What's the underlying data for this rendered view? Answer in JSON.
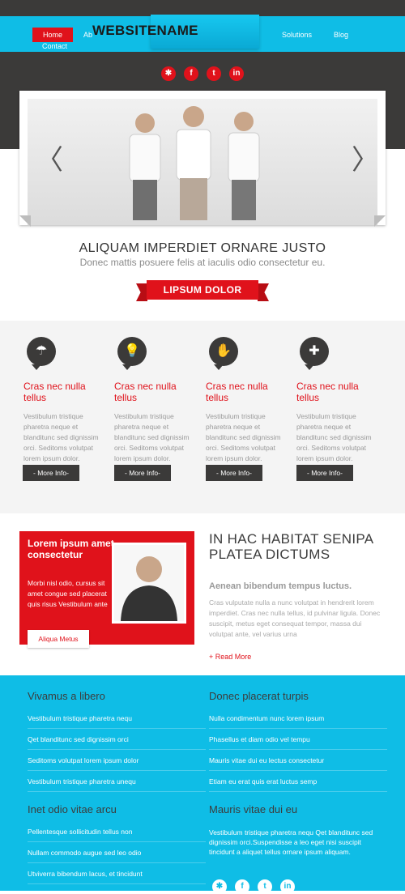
{
  "nav": {
    "logo": "WEBSITENAME",
    "home": "Home",
    "about": "Ab",
    "solutions": "Solutions",
    "blog": "Blog",
    "contact": "Contact"
  },
  "social": [
    {
      "icon": "stumbleupon-icon",
      "glyph": "✱"
    },
    {
      "icon": "facebook-icon",
      "glyph": "f"
    },
    {
      "icon": "twitter-icon",
      "glyph": "t"
    },
    {
      "icon": "linkedin-icon",
      "glyph": "in"
    }
  ],
  "hero": {
    "title": "ALIQUAM IMPERDIET ORNARE JUSTO",
    "subtitle": "Donec mattis posuere felis at iaculis odio consectetur eu.",
    "button": "LIPSUM DOLOR"
  },
  "features": [
    {
      "icon": "umbrella-icon",
      "glyph": "☂",
      "title": "Cras nec nulla tellus",
      "text": "Vestibulum tristique pharetra neque et blanditunc sed dignissim orci. Seditoms volutpat lorem ipsum dolor.",
      "button": "- More Info-"
    },
    {
      "icon": "lightbulb-icon",
      "glyph": "💡",
      "title": "Cras nec nulla tellus",
      "text": "Vestibulum tristique pharetra neque et blanditunc sed dignissim orci. Seditoms volutpat lorem ipsum dolor.",
      "button": "- More Info-"
    },
    {
      "icon": "hand-icon",
      "glyph": "✋",
      "title": "Cras nec nulla tellus",
      "text": "Vestibulum tristique pharetra neque et blanditunc sed dignissim orci. Seditoms volutpat lorem ipsum dolor.",
      "button": "- More Info-"
    },
    {
      "icon": "puzzle-icon",
      "glyph": "✚",
      "title": "Cras nec nulla tellus",
      "text": "Vestibulum tristique pharetra neque et blanditunc sed dignissim orci. Seditoms volutpat lorem ipsum dolor.",
      "button": "- More Info-"
    }
  ],
  "promo": {
    "title": "Lorem ipsum amet consectetur",
    "text": "Morbi nisl odio, cursus sit amet congue sed placerat quis risus Vestibulum ante",
    "button": "Aliqua Metus"
  },
  "about": {
    "title": "IN HAC HABITAT SENIPA PLATEA DICTUMS",
    "subtitle": "Aenean bibendum tempus luctus.",
    "text": "Cras vulputate nulla a nunc volutpat in hendrerit lorem imperdiet. Cras nec nulla tellus, id pulvinar ligula. Donec suscipit, metus eget consequat tempor, massa dui volutpat ante, vel varius urna",
    "link": "+ Read More"
  },
  "footer": {
    "col1_title": "Vivamus a libero",
    "col1_items": [
      "Vestibulum tristique pharetra nequ",
      "Qet blanditunc sed dignissim orci",
      "Seditoms volutpat lorem ipsum dolor",
      "Vestibulum tristique pharetra unequ"
    ],
    "col2_title": "Donec placerat turpis",
    "col2_items": [
      "Nulla condimentum nunc lorem ipsum",
      "Phasellus et diam odio vel tempu",
      "Mauris vitae dui eu lectus consectetur",
      "Etiam eu erat quis erat luctus semp"
    ],
    "col3_title": "Inet odio vitae arcu",
    "col3_items": [
      "Pellentesque sollicitudin tellus non",
      "Nullam commodo augue sed leo odio",
      "Utviverra bibendum lacus, et tincidunt"
    ],
    "col4_title": "Mauris vitae dui eu",
    "col4_text": "Vestibulum tristique pharetra nequ Qet blanditunc sed dignissim orci.Suspendisse a leo eget nisi suscipit tincidunt a aliquet tellus ornare ipsum aliquam."
  },
  "colors": {
    "accent": "#e0121b",
    "cyan": "#0fbde6",
    "dark": "#3b3a39"
  }
}
